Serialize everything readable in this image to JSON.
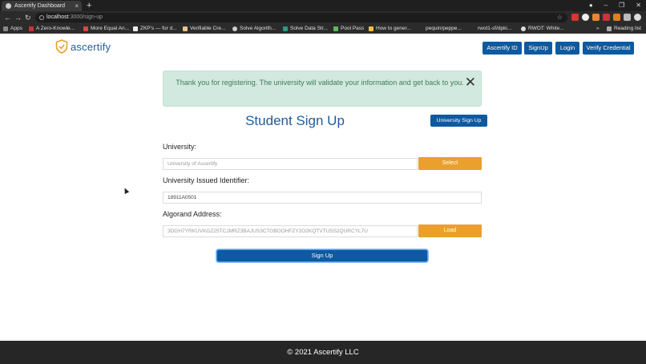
{
  "browser": {
    "tab_title": "Ascertify Dashboard",
    "tab_close": "×",
    "new_tab": "+",
    "url_host": "localhost",
    "url_path": ":3000/sign-up",
    "bookmarks": [
      "Apps",
      "A Zero-Knowle...",
      "More Equal An...",
      "ZKP's — for d...",
      "Verifiable Cre...",
      "Solve Algorith...",
      "Solve Data Str...",
      "Pool Pass",
      "How to gener...",
      "pequin/peppe...",
      "rwot1-sf/dpki...",
      "RWOT: White...",
      "Reading list"
    ]
  },
  "header": {
    "logo_text": "ascertify",
    "nav": [
      "Ascertify ID",
      "SignUp",
      "Login",
      "Verify Credential"
    ]
  },
  "alert": {
    "message": "Thank you for registering. The university will validate your information and get back to you.",
    "close_glyph": "✕"
  },
  "form": {
    "title": "Student Sign Up",
    "university_signup_label": "University Sign Up",
    "university_label": "University:",
    "university_placeholder": "University of Ascertify",
    "select_label": "Select",
    "identifier_label": "University Issued Identifier:",
    "identifier_value": "18911A0501",
    "address_label": "Algorand Address:",
    "address_value": "3DGH7YRKUVKGZ25TCJMRZ3BAJUS3C7GBOOHFZY2O2KQTVTUSS2QURCYL7U",
    "load_label": "Load",
    "submit_label": "Sign Up"
  },
  "footer": {
    "text": "© 2021 Ascertify LLC"
  },
  "colors": {
    "primary": "#0d5aa0",
    "accent": "#e9a02c",
    "alert_bg": "#d1e9de",
    "footer_bg": "#262626"
  }
}
